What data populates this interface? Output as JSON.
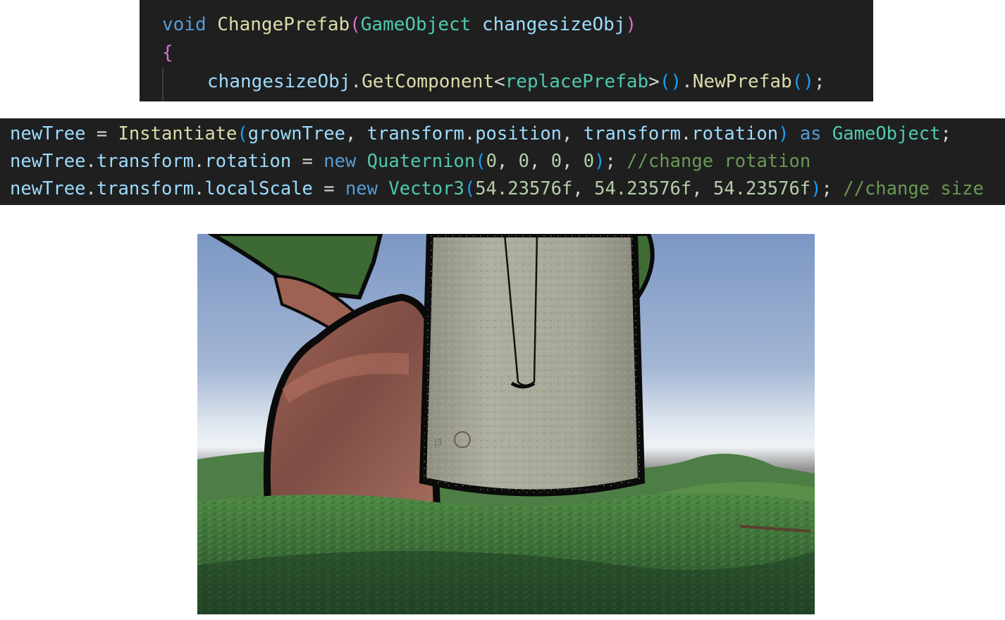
{
  "code_snippet_1": {
    "lines": [
      [
        {
          "t": "void",
          "c": "kw"
        },
        {
          "t": " ",
          "c": "plain"
        },
        {
          "t": "ChangePrefab",
          "c": "fn"
        },
        {
          "t": "(",
          "c": "paren"
        },
        {
          "t": "GameObject",
          "c": "type"
        },
        {
          "t": " ",
          "c": "plain"
        },
        {
          "t": "changesizeObj",
          "c": "var"
        },
        {
          "t": ")",
          "c": "paren"
        }
      ],
      [
        {
          "t": "{",
          "c": "brace"
        }
      ],
      [
        {
          "t": "changesizeObj",
          "c": "var"
        },
        {
          "t": ".",
          "c": "plain"
        },
        {
          "t": "GetComponent",
          "c": "fn"
        },
        {
          "t": "<",
          "c": "plain"
        },
        {
          "t": "replacePrefab",
          "c": "type"
        },
        {
          "t": ">",
          "c": "plain"
        },
        {
          "t": "()",
          "c": "paren2"
        },
        {
          "t": ".",
          "c": "plain"
        },
        {
          "t": "NewPrefab",
          "c": "fn"
        },
        {
          "t": "()",
          "c": "paren2"
        },
        {
          "t": ";",
          "c": "plain"
        }
      ]
    ]
  },
  "code_snippet_2": {
    "lines": [
      [
        {
          "t": "newTree",
          "c": "var"
        },
        {
          "t": " = ",
          "c": "plain"
        },
        {
          "t": "Instantiate",
          "c": "fn"
        },
        {
          "t": "(",
          "c": "paren2"
        },
        {
          "t": "grownTree",
          "c": "var"
        },
        {
          "t": ", ",
          "c": "plain"
        },
        {
          "t": "transform",
          "c": "var"
        },
        {
          "t": ".",
          "c": "plain"
        },
        {
          "t": "position",
          "c": "var"
        },
        {
          "t": ", ",
          "c": "plain"
        },
        {
          "t": "transform",
          "c": "var"
        },
        {
          "t": ".",
          "c": "plain"
        },
        {
          "t": "rotation",
          "c": "var"
        },
        {
          "t": ")",
          "c": "paren2"
        },
        {
          "t": " ",
          "c": "plain"
        },
        {
          "t": "as",
          "c": "kw"
        },
        {
          "t": " ",
          "c": "plain"
        },
        {
          "t": "GameObject",
          "c": "type"
        },
        {
          "t": ";",
          "c": "plain"
        }
      ],
      [
        {
          "t": "newTree",
          "c": "var"
        },
        {
          "t": ".",
          "c": "plain"
        },
        {
          "t": "transform",
          "c": "var"
        },
        {
          "t": ".",
          "c": "plain"
        },
        {
          "t": "rotation",
          "c": "var"
        },
        {
          "t": " = ",
          "c": "plain"
        },
        {
          "t": "new",
          "c": "kw"
        },
        {
          "t": " ",
          "c": "plain"
        },
        {
          "t": "Quaternion",
          "c": "type"
        },
        {
          "t": "(",
          "c": "paren2"
        },
        {
          "t": "0",
          "c": "num"
        },
        {
          "t": ", ",
          "c": "plain"
        },
        {
          "t": "0",
          "c": "num"
        },
        {
          "t": ", ",
          "c": "plain"
        },
        {
          "t": "0",
          "c": "num"
        },
        {
          "t": ", ",
          "c": "plain"
        },
        {
          "t": "0",
          "c": "num"
        },
        {
          "t": ")",
          "c": "paren2"
        },
        {
          "t": "; ",
          "c": "plain"
        },
        {
          "t": "//change rotation",
          "c": "comment"
        }
      ],
      [
        {
          "t": "newTree",
          "c": "var"
        },
        {
          "t": ".",
          "c": "plain"
        },
        {
          "t": "transform",
          "c": "var"
        },
        {
          "t": ".",
          "c": "plain"
        },
        {
          "t": "localScale",
          "c": "var"
        },
        {
          "t": " = ",
          "c": "plain"
        },
        {
          "t": "new",
          "c": "kw"
        },
        {
          "t": " ",
          "c": "plain"
        },
        {
          "t": "Vector3",
          "c": "type"
        },
        {
          "t": "(",
          "c": "paren2"
        },
        {
          "t": "54.23576f",
          "c": "num"
        },
        {
          "t": ", ",
          "c": "plain"
        },
        {
          "t": "54.23576f",
          "c": "num"
        },
        {
          "t": ", ",
          "c": "plain"
        },
        {
          "t": "54.23576f",
          "c": "num"
        },
        {
          "t": ")",
          "c": "paren2"
        },
        {
          "t": "; ",
          "c": "plain"
        },
        {
          "t": "//change size",
          "c": "comment"
        }
      ]
    ]
  },
  "colors": {
    "editor_background": "#1f1f1f",
    "keyword": "#569cd6",
    "function": "#dcdcaa",
    "type": "#4ec9b0",
    "variable": "#9cdcfe",
    "number": "#b5cea8",
    "comment": "#6a9955",
    "sky_top": "#7c98c6",
    "grass": "#3f6b3c",
    "trunk": "#a8a89a",
    "mushroom_cap": "#8a5548"
  }
}
